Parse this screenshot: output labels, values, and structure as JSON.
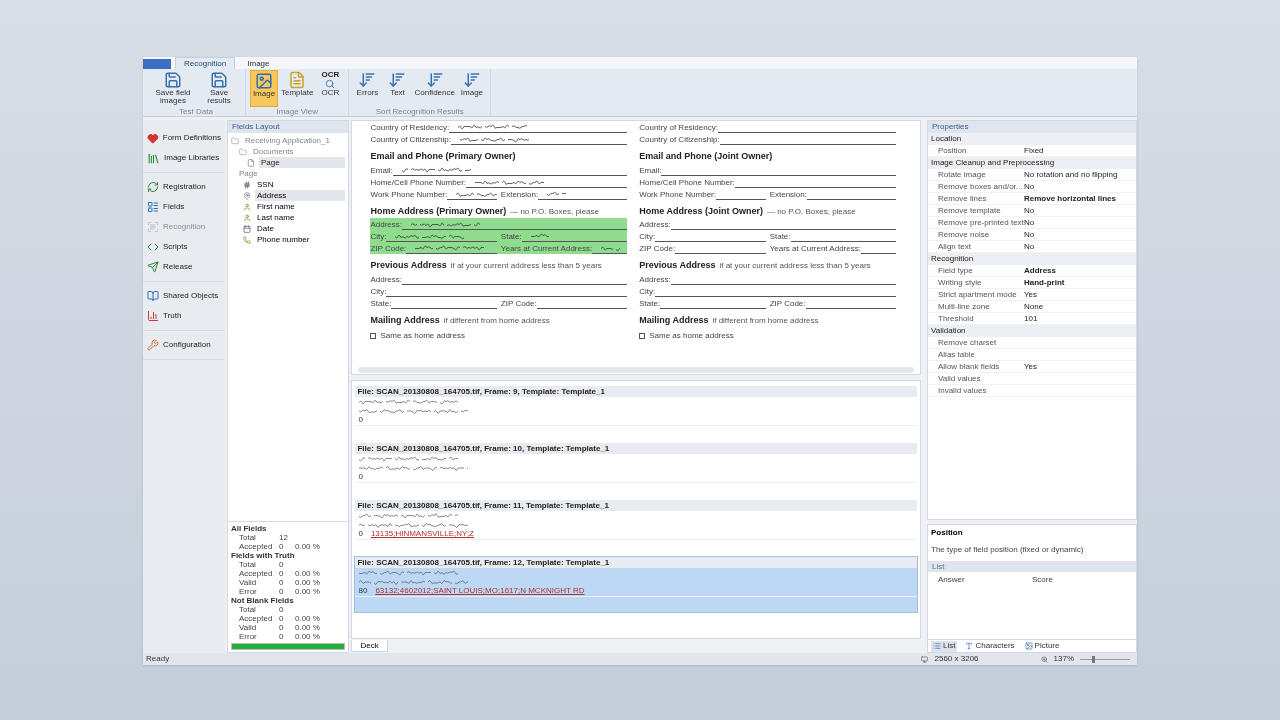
{
  "ribbon_tabs": [
    {
      "label": "Recognition",
      "selected": true
    },
    {
      "label": "Image",
      "selected": false
    }
  ],
  "ribbon_groups": [
    {
      "label": "Test Data",
      "buttons": [
        {
          "label": "Save field images",
          "kind": "save",
          "selected": false
        },
        {
          "label": "Save results",
          "kind": "save",
          "selected": false
        }
      ]
    },
    {
      "label": "Image View",
      "buttons": [
        {
          "label": "Image",
          "kind": "image",
          "selected": true
        },
        {
          "label": "Template",
          "kind": "template",
          "selected": false
        },
        {
          "label": "OCR",
          "kind": "ocr",
          "icon_text": "OCR",
          "selected": false
        }
      ]
    },
    {
      "label": "Sort Recognition Results",
      "buttons": [
        {
          "label": "Errors",
          "kind": "sort",
          "selected": false
        },
        {
          "label": "Text",
          "kind": "sort",
          "selected": false
        },
        {
          "label": "Confidence",
          "kind": "sort",
          "selected": false
        },
        {
          "label": "Image",
          "kind": "sort",
          "selected": false
        }
      ]
    }
  ],
  "nav_groups": [
    [
      {
        "label": "Form Definitions",
        "kind": "heart",
        "disabled": false
      },
      {
        "label": "Image Libraries",
        "kind": "books",
        "disabled": false
      }
    ],
    [
      {
        "label": "Registration",
        "kind": "refresh",
        "disabled": false
      },
      {
        "label": "Fields",
        "kind": "fields",
        "disabled": false
      },
      {
        "label": "Recognition",
        "kind": "scan",
        "disabled": true
      },
      {
        "label": "Scripts",
        "kind": "code",
        "disabled": false
      },
      {
        "label": "Release",
        "kind": "send",
        "disabled": false
      }
    ],
    [
      {
        "label": "Shared Objects",
        "kind": "book",
        "disabled": false
      },
      {
        "label": "Truth",
        "kind": "chart",
        "disabled": false
      }
    ],
    [
      {
        "label": "Configuration",
        "kind": "wrench",
        "disabled": false
      }
    ]
  ],
  "fields_layout": {
    "title": "Fields Layout",
    "tree": [
      {
        "label": "Receiving Application_1",
        "selected": false,
        "children": [
          {
            "label": "Documents",
            "selected": false,
            "children": [
              {
                "label": "Page",
                "selected": true
              }
            ]
          }
        ]
      }
    ],
    "page_label": "Page",
    "fields": [
      {
        "label": "SSN",
        "kind": "number",
        "selected": false
      },
      {
        "label": "Address",
        "kind": "address",
        "selected": true
      },
      {
        "label": "First name",
        "kind": "person",
        "selected": false
      },
      {
        "label": "Last name",
        "kind": "person",
        "selected": false
      },
      {
        "label": "Date",
        "kind": "date",
        "selected": false
      },
      {
        "label": "Phone number",
        "kind": "phone",
        "selected": false
      }
    ]
  },
  "statistics": {
    "groups": [
      {
        "title": "All Fields",
        "rows": [
          {
            "label": "Total",
            "count": "12"
          },
          {
            "label": "Accepted",
            "count": "0",
            "percent": "0.00 %"
          }
        ]
      },
      {
        "title": "Fields with Truth",
        "rows": [
          {
            "label": "Total",
            "count": "0"
          },
          {
            "label": "Accepted",
            "count": "0",
            "percent": "0.00 %"
          },
          {
            "label": "Valid",
            "count": "0",
            "percent": "0.00 %"
          },
          {
            "label": "Error",
            "count": "0",
            "percent": "0.00 %"
          }
        ]
      },
      {
        "title": "Not Blank Fields",
        "rows": [
          {
            "label": "Total",
            "count": "0"
          },
          {
            "label": "Accepted",
            "count": "0",
            "percent": "0.00 %"
          },
          {
            "label": "Valid",
            "count": "0",
            "percent": "0.00 %"
          },
          {
            "label": "Error",
            "count": "0",
            "percent": "0.00 %"
          }
        ]
      }
    ],
    "level": 1
  },
  "document": {
    "columns": [
      {
        "rows": [
          {
            "kind": "line",
            "labels": [
              "Country of Residency:"
            ],
            "handwritten": true,
            "highlighted": false
          },
          {
            "kind": "line",
            "labels": [
              "Country of Citizenship:"
            ],
            "handwritten": true,
            "highlighted": false
          },
          {
            "kind": "heading",
            "label": "Email and Phone (Primary Owner)"
          },
          {
            "kind": "line",
            "labels": [
              "Email:"
            ],
            "handwritten": true,
            "highlighted": false
          },
          {
            "kind": "line",
            "labels": [
              "Home/Cell Phone Number:"
            ],
            "handwritten": true,
            "highlighted": false
          },
          {
            "kind": "line",
            "labels": [
              "Work Phone Number:",
              "Extension:"
            ],
            "handwritten": true,
            "highlighted": false
          },
          {
            "kind": "heading",
            "label": "Home Address (Primary Owner)",
            "note": "— no P.O. Boxes, please"
          },
          {
            "kind": "line",
            "labels": [
              "Address:"
            ],
            "handwritten": true,
            "highlighted": true
          },
          {
            "kind": "line",
            "labels": [
              "City:",
              "State:"
            ],
            "handwritten": true,
            "highlighted": true
          },
          {
            "kind": "line",
            "labels": [
              "ZIP Code:",
              "Years at Current Address:"
            ],
            "handwritten": true,
            "highlighted": true
          },
          {
            "kind": "heading",
            "label": "Previous Address",
            "note": "if at your current address less than 5 years"
          },
          {
            "kind": "line",
            "labels": [
              "Address:"
            ],
            "handwritten": false,
            "highlighted": false
          },
          {
            "kind": "line",
            "labels": [
              "City:"
            ],
            "handwritten": false,
            "highlighted": false
          },
          {
            "kind": "line",
            "labels": [
              "State:",
              "ZIP Code:"
            ],
            "handwritten": false,
            "highlighted": false
          },
          {
            "kind": "heading",
            "label": "Mailing Address",
            "note": "if different from home address"
          },
          {
            "kind": "check",
            "label": "Same as home address",
            "checked": false
          }
        ]
      },
      {
        "rows": [
          {
            "kind": "line",
            "labels": [
              "Country of Residency:"
            ],
            "handwritten": false,
            "highlighted": false
          },
          {
            "kind": "line",
            "labels": [
              "Country of Citizenship:"
            ],
            "handwritten": false,
            "highlighted": false
          },
          {
            "kind": "heading",
            "label": "Email and Phone (Joint Owner)"
          },
          {
            "kind": "line",
            "labels": [
              "Email:"
            ],
            "handwritten": false,
            "highlighted": false
          },
          {
            "kind": "line",
            "labels": [
              "Home/Cell Phone Number:"
            ],
            "handwritten": false,
            "highlighted": false
          },
          {
            "kind": "line",
            "labels": [
              "Work Phone Number:",
              "Extension:"
            ],
            "handwritten": false,
            "highlighted": false
          },
          {
            "kind": "heading",
            "label": "Home Address (Joint Owner)",
            "note": "— no P.O. Boxes, please"
          },
          {
            "kind": "line",
            "labels": [
              "Address:"
            ],
            "handwritten": false,
            "highlighted": false
          },
          {
            "kind": "line",
            "labels": [
              "City:",
              "State:"
            ],
            "handwritten": false,
            "highlighted": false
          },
          {
            "kind": "line",
            "labels": [
              "ZIP Code:",
              "Years at Current Address:"
            ],
            "handwritten": false,
            "highlighted": false
          },
          {
            "kind": "heading",
            "label": "Previous Address",
            "note": "if at your current address less than 5 years"
          },
          {
            "kind": "line",
            "labels": [
              "Address:"
            ],
            "handwritten": false,
            "highlighted": false
          },
          {
            "kind": "line",
            "labels": [
              "City:"
            ],
            "handwritten": false,
            "highlighted": false
          },
          {
            "kind": "line",
            "labels": [
              "State:",
              "ZIP Code:"
            ],
            "handwritten": false,
            "highlighted": false
          },
          {
            "kind": "heading",
            "label": "Mailing Address",
            "note": "if different from home address"
          },
          {
            "kind": "check",
            "label": "Same as home address",
            "checked": false
          }
        ]
      }
    ]
  },
  "records": [
    {
      "header": "File: SCAN_20130808_164705.tif, Frame: 9, Template: Template_1",
      "number": "0",
      "selected": false
    },
    {
      "header": "File: SCAN_20130808_164705.tif, Frame: 10, Template: Template_1",
      "number": "0",
      "selected": false
    },
    {
      "header": "File: SCAN_20130808_164705.tif, Frame: 11, Template: Template_1",
      "number": "0",
      "value": "13135;HINMANSVILLE;NY;Z",
      "selected": false
    },
    {
      "header": "File: SCAN_20130808_164705.tif, Frame: 12, Template: Template_1",
      "number": "80",
      "value": "63132;4602012;SAINT LOUIS;MO;1617;N MCKNIGHT RD",
      "selected": true
    }
  ],
  "deck_tab": "Deck",
  "properties": {
    "title": "Properties",
    "categories": [
      {
        "name": "Location",
        "rows": [
          {
            "name": "Position",
            "value": "Fixed",
            "bold": false
          }
        ]
      },
      {
        "name": "Image Cleanup and Preprocessing",
        "rows": [
          {
            "name": "Rotate image",
            "value": "No rotation and no flipping",
            "bold": false
          },
          {
            "name": "Remove boxes and/or...",
            "value": "No",
            "bold": false
          },
          {
            "name": "Remove lines",
            "value": "Remove horizontal lines",
            "bold": true
          },
          {
            "name": "Remove template",
            "value": "No",
            "bold": false
          },
          {
            "name": "Remove pre-printed text",
            "value": "No",
            "bold": false
          },
          {
            "name": "Remove noise",
            "value": "No",
            "bold": false
          },
          {
            "name": "Align text",
            "value": "No",
            "bold": false
          }
        ]
      },
      {
        "name": "Recognition",
        "rows": [
          {
            "name": "Field type",
            "value": "Address",
            "bold": true
          },
          {
            "name": "Writing style",
            "value": "Hand-print",
            "bold": true
          },
          {
            "name": "Strict apartment mode",
            "value": "Yes",
            "bold": false
          },
          {
            "name": "Multi-line zone",
            "value": "None",
            "bold": false
          },
          {
            "name": "Threshold",
            "value": "101",
            "bold": false
          }
        ]
      },
      {
        "name": "Validation",
        "rows": [
          {
            "name": "Remove charset"
          },
          {
            "name": "Alias table"
          },
          {
            "name": "Allow blank fields",
            "value": "Yes",
            "bold": false
          },
          {
            "name": "Valid values"
          },
          {
            "name": "Invalid values"
          }
        ]
      }
    ]
  },
  "description": {
    "title": "Position",
    "text": "The type of field position (fixed or dynamic)"
  },
  "answer_list": {
    "title": "List",
    "columns": [
      "Answer",
      "Score"
    ]
  },
  "bottom_tabs": [
    {
      "label": "List",
      "kind": "list",
      "selected": true
    },
    {
      "label": "Characters",
      "kind": "chars",
      "selected": false
    },
    {
      "label": "Picture",
      "kind": "picture",
      "selected": false
    }
  ],
  "status_bar": {
    "text": "Ready",
    "image_size": "2560 x 3206",
    "zoom": "137%",
    "zoom_slider": {
      "level": 0.25
    }
  }
}
